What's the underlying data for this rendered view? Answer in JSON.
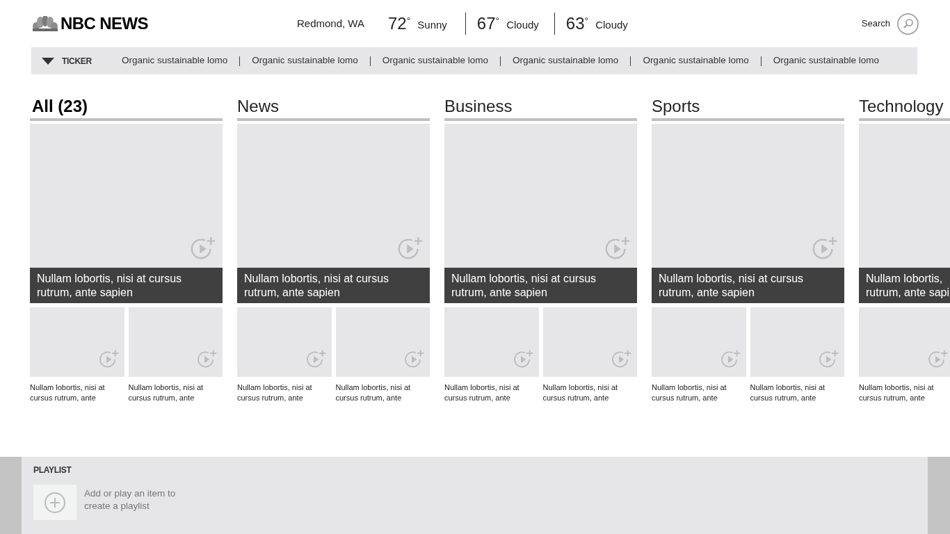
{
  "header": {
    "logo_text": "NBC NEWS",
    "location": "Redmond, WA",
    "forecast": [
      {
        "temp": "72",
        "degree": "°",
        "condition": "Sunny"
      },
      {
        "temp": "67",
        "degree": "°",
        "condition": "Cloudy"
      },
      {
        "temp": "63",
        "degree": "°",
        "condition": "Cloudy"
      }
    ],
    "search": {
      "label": "Search"
    }
  },
  "ticker": {
    "label": "TICKER",
    "items": [
      "Organic sustainable lomo",
      "Organic sustainable lomo",
      "Organic sustainable lomo",
      "Organic sustainable lomo",
      "Organic sustainable lomo",
      "Organic sustainable lomo"
    ]
  },
  "sections": [
    {
      "title": "All (23)",
      "selected": true,
      "feature": {
        "headline": [
          "Nullam lobortis, nisi at cursus",
          "rutrum, ante sapien"
        ]
      },
      "stories": [
        {
          "caption": [
            "Nullam lobortis, nisi at",
            "cursus rutrum, ante"
          ]
        },
        {
          "caption": [
            "Nullam lobortis, nisi at",
            "cursus rutrum, ante"
          ]
        }
      ]
    },
    {
      "title": "News",
      "selected": false,
      "feature": {
        "headline": [
          "Nullam lobortis, nisi at cursus",
          "rutrum, ante sapien"
        ]
      },
      "stories": [
        {
          "caption": [
            "Nullam lobortis, nisi at",
            "cursus rutrum, ante"
          ]
        },
        {
          "caption": [
            "Nullam lobortis, nisi at",
            "cursus rutrum, ante"
          ]
        }
      ]
    },
    {
      "title": "Business",
      "selected": false,
      "feature": {
        "headline": [
          "Nullam lobortis, nisi at cursus",
          "rutrum, ante sapien"
        ]
      },
      "stories": [
        {
          "caption": [
            "Nullam lobortis, nisi at",
            "cursus rutrum, ante"
          ]
        },
        {
          "caption": [
            "Nullam lobortis, nisi at",
            "cursus rutrum, ante"
          ]
        }
      ]
    },
    {
      "title": "Sports",
      "selected": false,
      "feature": {
        "headline": [
          "Nullam lobortis, nisi at cursus",
          "rutrum, ante sapien"
        ]
      },
      "stories": [
        {
          "caption": [
            "Nullam lobortis, nisi at",
            "cursus rutrum, ante"
          ]
        },
        {
          "caption": [
            "Nullam lobortis, nisi at",
            "cursus rutrum, ante"
          ]
        }
      ]
    },
    {
      "title": "Technology",
      "selected": false,
      "feature": {
        "headline": [
          "Nullam lobortis,",
          "rutrum, ante sapi"
        ]
      },
      "stories": [
        {
          "caption": [
            "Nullam lobortis, nisi at",
            "cursus rutrum, ante"
          ]
        }
      ]
    }
  ],
  "playlist": {
    "title": "PLAYLIST",
    "hint": [
      "Add or play an item to",
      "create a playlist"
    ]
  }
}
